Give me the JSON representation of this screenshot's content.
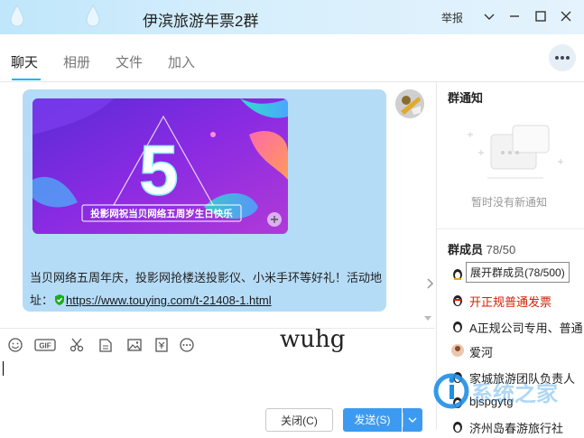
{
  "window": {
    "title": "伊滨旅游年票2群",
    "report_label": "举报",
    "icons": [
      "dropdown-arrow-icon",
      "minimize-icon",
      "maximize-icon",
      "close-icon"
    ]
  },
  "tabs": [
    {
      "label": "聊天",
      "active": true
    },
    {
      "label": "相册",
      "active": false
    },
    {
      "label": "文件",
      "active": false
    },
    {
      "label": "加入",
      "active": false
    }
  ],
  "message": {
    "banner_number": "5",
    "banner_caption": "投影网祝当贝网络五周岁生日快乐",
    "text": "当贝网络五周年庆，投影网抢楼送投影仪、小米手环等好礼！活动地",
    "link_prefix": "址：",
    "link": "https://www.touying.com/t-21408-1.html"
  },
  "editor": {
    "typed_text": "wuhg",
    "toolbar_icons": [
      "emoji-icon",
      "gif-icon",
      "scissors-icon",
      "doc-icon",
      "image-icon",
      "receipt-icon",
      "more-icon"
    ]
  },
  "buttons": {
    "close_label": "关闭(C)",
    "send_label": "发送(S)"
  },
  "notice": {
    "title": "群通知",
    "empty_text": "暂时没有新通知"
  },
  "members": {
    "title": "群成员",
    "count": "78/50",
    "tooltip": "展开群成员(78/500)",
    "list": [
      {
        "name": "",
        "color": "#222"
      },
      {
        "name": "开正规普通发票",
        "color": "#d81e06"
      },
      {
        "name": "A正规公司专用、普通",
        "color": "#222"
      },
      {
        "name": "爱河",
        "color": "#222"
      },
      {
        "name": "家城旅游团队负责人",
        "color": "#222"
      },
      {
        "name": "bjspgytg",
        "color": "#222"
      },
      {
        "name": "济州岛春游旅行社",
        "color": "#222"
      }
    ]
  },
  "watermark": {
    "text": "系统之家"
  },
  "colors": {
    "accent": "#12b7f5",
    "bubble": "#b5dcf7",
    "send_button": "#3c9bf0",
    "title_bar": "#cfeafb"
  }
}
